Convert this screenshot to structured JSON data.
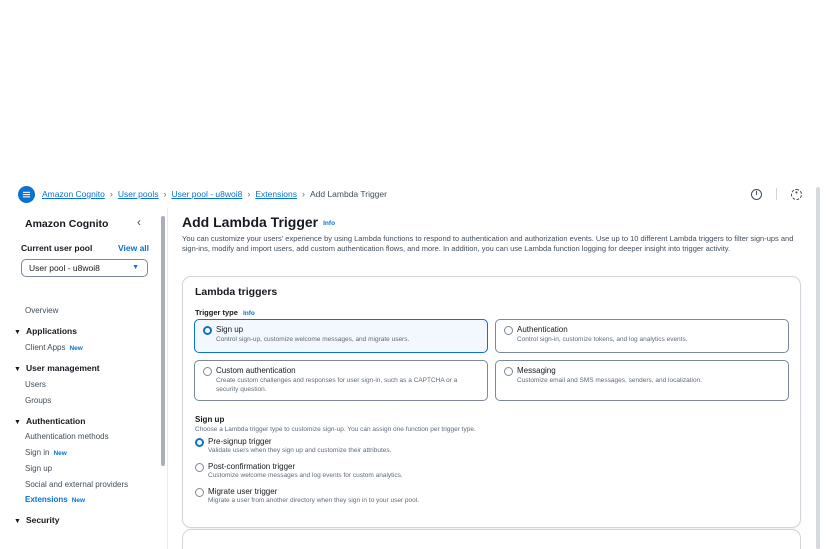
{
  "breadcrumbs": [
    "Amazon Cognito",
    "User pools",
    "User pool - u8woi8",
    "Extensions"
  ],
  "breadcrumb_current": "Add Lambda Trigger",
  "top_icons": [
    "info-icon",
    "settings-icon"
  ],
  "sidebar": {
    "title": "Amazon Cognito",
    "current_pool_label": "Current user pool",
    "view_all": "View all",
    "pool_select_value": "User pool - u8woi8",
    "overview": "Overview",
    "sections": {
      "applications": "Applications",
      "user_management": "User management",
      "authentication": "Authentication",
      "security": "Security"
    },
    "items": {
      "client_apps": "Client Apps",
      "users": "Users",
      "groups": "Groups",
      "auth_methods": "Authentication methods",
      "sign_in": "Sign in",
      "sign_up": "Sign up",
      "social": "Social and external providers",
      "extensions": "Extensions"
    },
    "new_badge": "New"
  },
  "main": {
    "title": "Add Lambda Trigger",
    "info": "Info",
    "description": "You can customize your users' experience by using Lambda functions to respond to authentication and authorization events. Use up to 10 different Lambda triggers to filter sign-ups and sign-ins, modify and import users, add custom authentication flows, and more. In addition, you can use Lambda function logging for deeper insight into trigger activity.",
    "panel_title": "Lambda triggers",
    "trigger_type_label": "Trigger type",
    "trigger_type_info": "Info",
    "tiles": [
      {
        "title": "Sign up",
        "desc": "Control sign-up, customize welcome messages, and migrate users.",
        "selected": true
      },
      {
        "title": "Authentication",
        "desc": "Control sign-in, customize tokens, and log analytics events.",
        "selected": false
      },
      {
        "title": "Custom authentication",
        "desc": "Create custom challenges and responses for user sign-in, such as a CAPTCHA or a security question.",
        "selected": false
      },
      {
        "title": "Messaging",
        "desc": "Customize email and SMS messages, senders, and localization.",
        "selected": false
      }
    ],
    "signup_title": "Sign up",
    "signup_desc": "Choose a Lambda trigger type to customize sign-up. You can assign one function per trigger type.",
    "options": [
      {
        "label": "Pre-signup trigger",
        "desc": "Validate users when they sign up and customize their attributes.",
        "selected": true
      },
      {
        "label": "Post-confirmation trigger",
        "desc": "Customize welcome messages and log events for custom analytics.",
        "selected": false
      },
      {
        "label": "Migrate user trigger",
        "desc": "Migrate a user from another directory when they sign in to your user pool.",
        "selected": false
      }
    ]
  }
}
